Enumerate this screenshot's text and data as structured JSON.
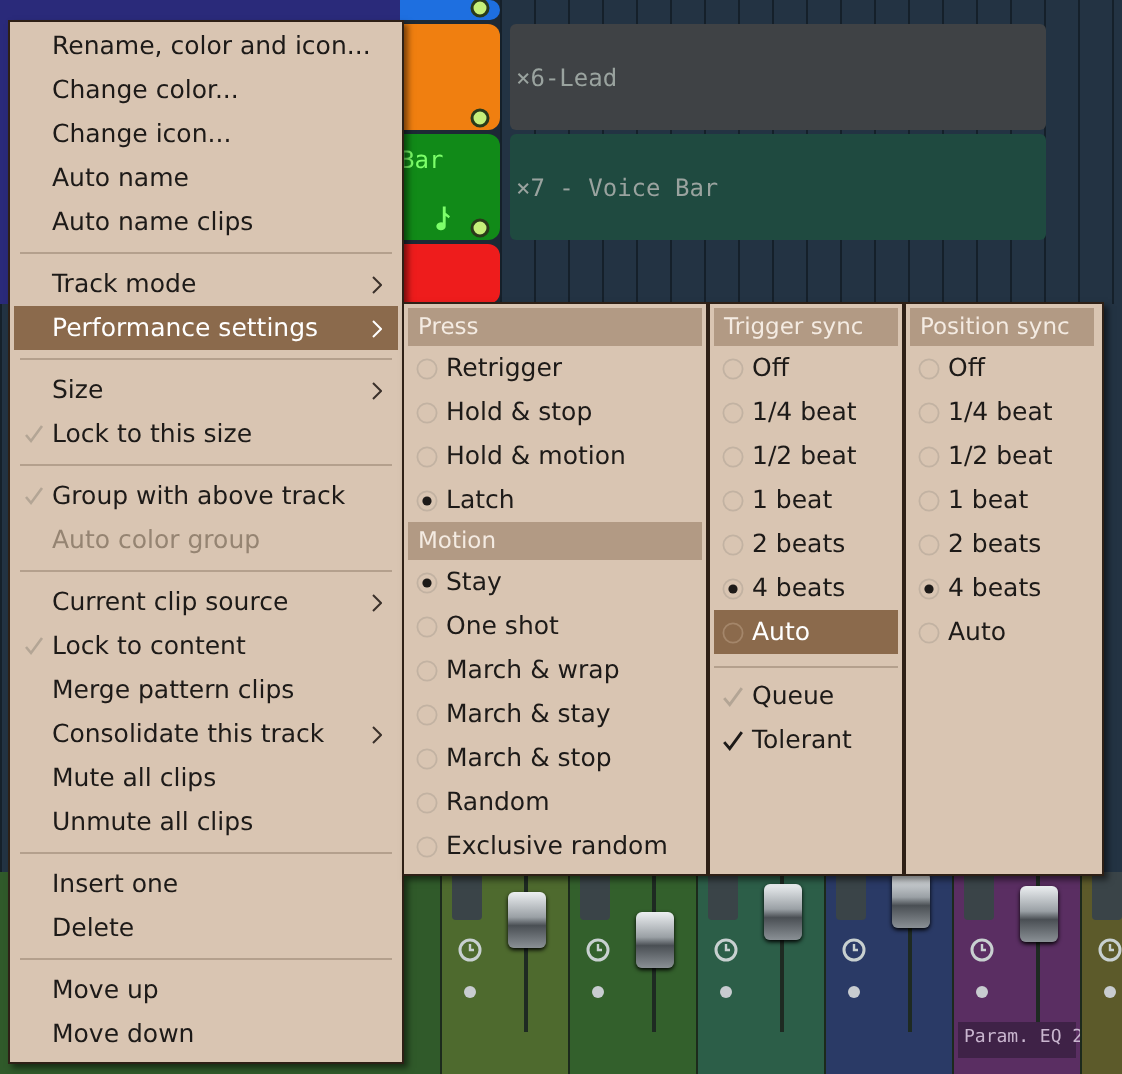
{
  "playlist": {
    "track_headers": [
      {
        "color": "#1e6fe0"
      },
      {
        "color": "#f07f10"
      },
      {
        "color": "#118a18",
        "label": "Bar"
      },
      {
        "color": "#ee1c1c"
      }
    ],
    "clips": [
      {
        "label": "×6-Lead",
        "color": "#3f4245"
      },
      {
        "label": "×7 - Voice Bar",
        "color": "#1f4a40"
      }
    ]
  },
  "mixer": {
    "strips": [
      {
        "color": "#4e6a2e",
        "level": 0.81
      },
      {
        "color": "#33602c",
        "level": 0.62
      },
      {
        "color": "#2c5e48",
        "level": 0.88
      },
      {
        "color": "#2a3a66",
        "level": 1.0
      },
      {
        "color": "#5a2e62",
        "level": 0.87,
        "label": "Param. EQ 2"
      },
      {
        "color": "#5c5a2a"
      }
    ]
  },
  "menu": {
    "items": [
      {
        "kind": "item",
        "label": "Rename, color and icon..."
      },
      {
        "kind": "item",
        "label": "Change color..."
      },
      {
        "kind": "item",
        "label": "Change icon..."
      },
      {
        "kind": "item",
        "label": "Auto name"
      },
      {
        "kind": "item",
        "label": "Auto name clips"
      },
      {
        "kind": "separator"
      },
      {
        "kind": "item",
        "label": "Track mode",
        "submenu": true,
        "highlighted": false
      },
      {
        "kind": "item",
        "label": "Performance settings",
        "submenu": true,
        "highlighted": true
      },
      {
        "kind": "separator"
      },
      {
        "kind": "item",
        "label": "Size",
        "submenu": true,
        "highlighted": false
      },
      {
        "kind": "item",
        "label": "Lock to this size",
        "checked": false
      },
      {
        "kind": "separator"
      },
      {
        "kind": "item",
        "label": "Group with above track",
        "checked": false
      },
      {
        "kind": "item",
        "label": "Auto color group",
        "disabled": true
      },
      {
        "kind": "separator"
      },
      {
        "kind": "item",
        "label": "Current clip source",
        "submenu": true,
        "highlighted": false
      },
      {
        "kind": "item",
        "label": "Lock to content",
        "checked": false
      },
      {
        "kind": "item",
        "label": "Merge pattern clips"
      },
      {
        "kind": "item",
        "label": "Consolidate this track",
        "submenu": true,
        "highlighted": false
      },
      {
        "kind": "item",
        "label": "Mute all clips"
      },
      {
        "kind": "item",
        "label": "Unmute all clips"
      },
      {
        "kind": "separator"
      },
      {
        "kind": "item",
        "label": "Insert one"
      },
      {
        "kind": "item",
        "label": "Delete"
      },
      {
        "kind": "separator"
      },
      {
        "kind": "item",
        "label": "Move up"
      },
      {
        "kind": "item",
        "label": "Move down"
      }
    ]
  },
  "performance_submenu": {
    "columns": [
      {
        "sections": [
          {
            "header": "Press",
            "options": [
              {
                "label": "Retrigger",
                "selected": false
              },
              {
                "label": "Hold & stop",
                "selected": false
              },
              {
                "label": "Hold & motion",
                "selected": false
              },
              {
                "label": "Latch",
                "selected": true
              }
            ]
          },
          {
            "header": "Motion",
            "options": [
              {
                "label": "Stay",
                "selected": true
              },
              {
                "label": "One shot",
                "selected": false
              },
              {
                "label": "March & wrap",
                "selected": false
              },
              {
                "label": "March & stay",
                "selected": false
              },
              {
                "label": "March & stop",
                "selected": false
              },
              {
                "label": "Random",
                "selected": false
              },
              {
                "label": "Exclusive random",
                "selected": false
              }
            ]
          }
        ]
      },
      {
        "sections": [
          {
            "header": "Trigger sync",
            "options": [
              {
                "label": "Off",
                "selected": false
              },
              {
                "label": "1/4 beat",
                "selected": false
              },
              {
                "label": "1/2 beat",
                "selected": false
              },
              {
                "label": "1 beat",
                "selected": false
              },
              {
                "label": "2 beats",
                "selected": false
              },
              {
                "label": "4 beats",
                "selected": true
              },
              {
                "label": "Auto",
                "selected": false,
                "highlighted": true
              }
            ]
          }
        ],
        "toggles": [
          {
            "label": "Queue",
            "checked": false
          },
          {
            "label": "Tolerant",
            "checked": true
          }
        ]
      },
      {
        "sections": [
          {
            "header": "Position sync",
            "options": [
              {
                "label": "Off",
                "selected": false
              },
              {
                "label": "1/4 beat",
                "selected": false
              },
              {
                "label": "1/2 beat",
                "selected": false
              },
              {
                "label": "1 beat",
                "selected": false
              },
              {
                "label": "2 beats",
                "selected": false
              },
              {
                "label": "4 beats",
                "selected": true
              },
              {
                "label": "Auto",
                "selected": false
              }
            ]
          }
        ]
      }
    ]
  }
}
